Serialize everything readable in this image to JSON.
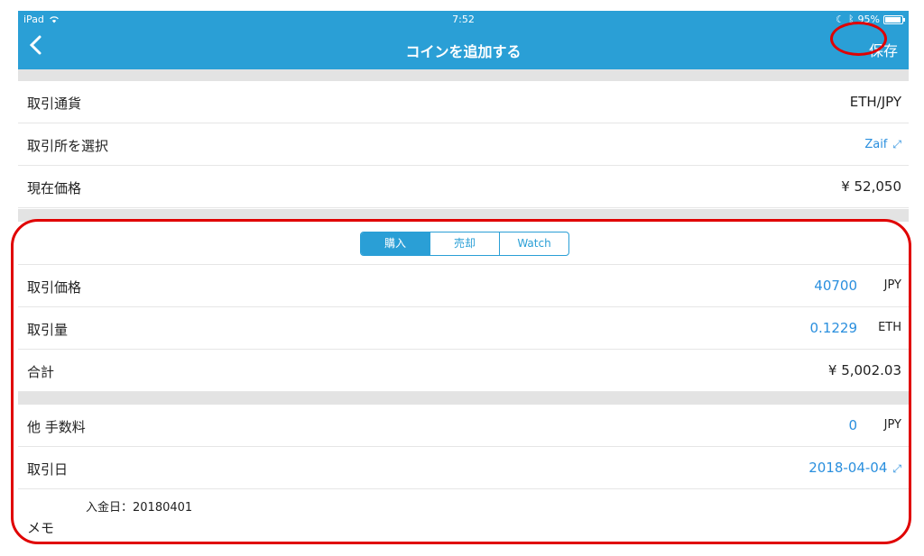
{
  "status_bar": {
    "device": "iPad",
    "time": "7:52",
    "battery": "95%",
    "battery_level": 0.95
  },
  "nav": {
    "back_icon": "chevron-left-icon",
    "title": "コインを追加する",
    "save_label": "保存"
  },
  "info": {
    "pair_label": "取引通貨",
    "pair_value": "ETH/JPY",
    "exchange_label": "取引所を選択",
    "exchange_value": "Zaif",
    "price_label": "現在価格",
    "price_value": "¥ 52,050"
  },
  "segment": {
    "options": [
      "購入",
      "売却",
      "Watch"
    ],
    "selected": "購入"
  },
  "trade": {
    "price_label": "取引価格",
    "price_value": "40700",
    "price_unit": "JPY",
    "amount_label": "取引量",
    "amount_value": "0.1229",
    "amount_unit": "ETH",
    "total_label": "合計",
    "total_value": "¥ 5,002.03"
  },
  "extra": {
    "fee_label": "他 手数料",
    "fee_value": "0",
    "fee_unit": "JPY",
    "date_label": "取引日",
    "date_value": "2018-04-04",
    "memo_label": "メモ",
    "memo_value": "入金日：20180401"
  },
  "colors": {
    "accent": "#2a9fd6",
    "highlight": "#e00000",
    "value_blue": "#2a8fde"
  }
}
